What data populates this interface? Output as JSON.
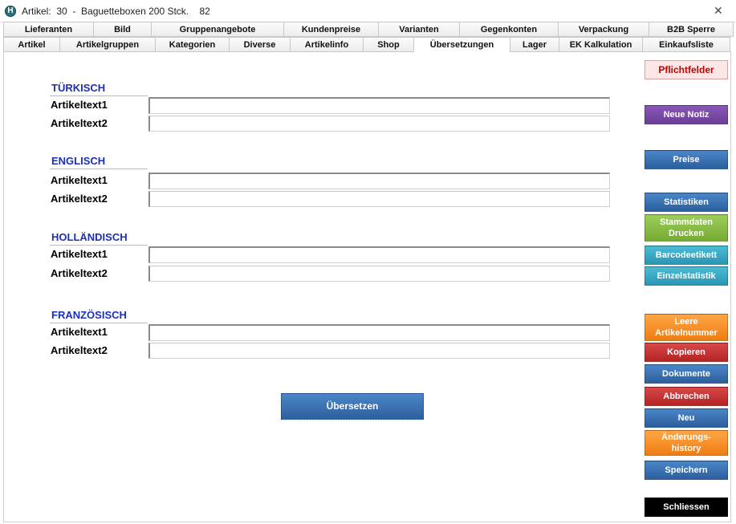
{
  "window": {
    "title": "Artikel:  30  -  Baguetteboxen 200 Stck.    82"
  },
  "tabs": {
    "row1": [
      "Lieferanten",
      "Bild",
      "Gruppenangebote",
      "Kundenpreise",
      "Varianten",
      "Gegenkonten",
      "Verpackung",
      "B2B Sperre"
    ],
    "row2": [
      "Artikel",
      "Artikelgruppen",
      "Kategorien",
      "Diverse",
      "Artikelinfo",
      "Shop",
      "Übersetzungen",
      "Lager",
      "EK Kalkulation",
      "Einkaufsliste"
    ],
    "active": "Übersetzungen"
  },
  "sections": [
    {
      "title": "TÜRKISCH",
      "fields": [
        {
          "label": "Artikeltext1",
          "value": ""
        },
        {
          "label": "Artikeltext2",
          "value": ""
        }
      ]
    },
    {
      "title": "ENGLISCH",
      "fields": [
        {
          "label": "Artikeltext1",
          "value": ""
        },
        {
          "label": "Artikeltext2",
          "value": ""
        }
      ]
    },
    {
      "title": "HOLLÄNDISCH",
      "fields": [
        {
          "label": "Artikeltext1",
          "value": ""
        },
        {
          "label": "Artikeltext2",
          "value": ""
        }
      ]
    },
    {
      "title": "FRANZÖSISCH",
      "fields": [
        {
          "label": "Artikeltext1",
          "value": ""
        },
        {
          "label": "Artikeltext2",
          "value": ""
        }
      ]
    }
  ],
  "translate_button": "Übersetzen",
  "sidebar": {
    "pflichtfelder": "Pflichtfelder",
    "neue_notiz": "Neue Notiz",
    "preise": "Preise",
    "statistiken": "Statistiken",
    "stammdaten_drucken_1": "Stammdaten",
    "stammdaten_drucken_2": "Drucken",
    "barcodeetikett": "Barcodeetikett",
    "einzelstatistik": "Einzelstatistik",
    "leere_artikelnummer_1": "Leere",
    "leere_artikelnummer_2": "Artikelnummer",
    "kopieren": "Kopieren",
    "dokumente": "Dokumente",
    "abbrechen": "Abbrechen",
    "neu": "Neu",
    "aenderungs_history_1": "Änderungs-",
    "aenderungs_history_2": "history",
    "speichern": "Speichern",
    "schliessen": "Schliessen"
  },
  "colors": {
    "section_title": "#1c2fb8",
    "blue_button": "#3a72b4",
    "purple_button": "#7b4aa8",
    "green_button": "#86bb45",
    "cyan_button": "#38a8c6",
    "orange_button": "#f58d2a",
    "red_button": "#c93434"
  },
  "icons": {
    "app": "app-logo-icon",
    "close": "close-icon"
  }
}
